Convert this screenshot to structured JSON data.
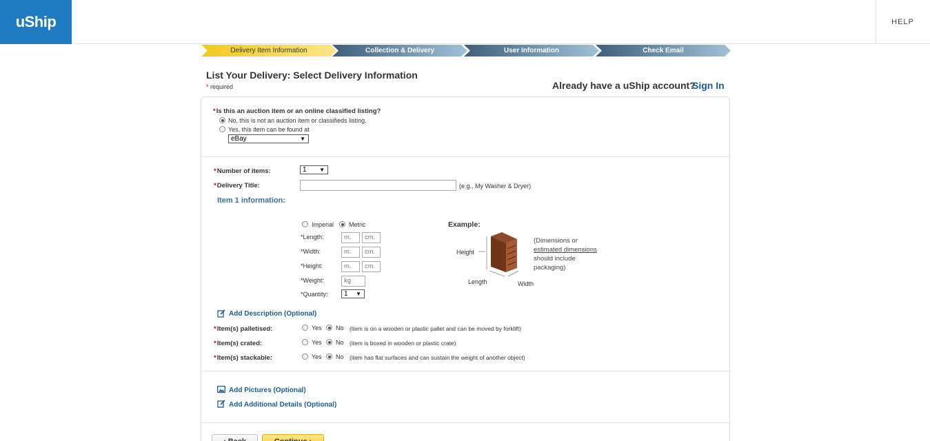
{
  "header": {
    "logo": "uShip",
    "help": "HELP",
    "brand_color": "#1f7bc1"
  },
  "steps": [
    {
      "label": "Delivery Item Information",
      "state": "active"
    },
    {
      "label": "Collection & Delivery",
      "state": "inactive"
    },
    {
      "label": "User Information",
      "state": "inactive"
    },
    {
      "label": "Check Email",
      "state": "inactive"
    }
  ],
  "page": {
    "title": "List Your Delivery:  Select Delivery Information",
    "required_star": "*",
    "required_note": "required",
    "account_question": "Already have a uShip account?",
    "sign_in": "Sign In"
  },
  "auction": {
    "question": "Is this an auction item or an online classified listing?",
    "option_no": "No, this is not an auction item or classifieds listing.",
    "option_yes": "Yes, this item can be found at",
    "selected": "no",
    "site_select": "eBay"
  },
  "items": {
    "count_label": "Number of items:",
    "count_value": "1",
    "title_label": "Delivery Title:",
    "title_value": "",
    "title_hint": "(e.g., My Washer & Dryer)",
    "item_info_heading": "Item 1 information:"
  },
  "dimensions": {
    "unit_imperial": "Imperial",
    "unit_metric": "Metric",
    "unit_selected": "metric",
    "length_label": "*Length:",
    "width_label": "*Width:",
    "height_label": "*Height:",
    "weight_label": "*Weight:",
    "quantity_label": "*Quantity:",
    "m_placeholder": "m.",
    "cm_placeholder": "cm.",
    "kg_placeholder": "kg",
    "quantity_value": "1"
  },
  "example": {
    "label": "Example:",
    "height": "Height",
    "length": "Length",
    "width": "Width",
    "note_line1": "(Dimensions or",
    "note_link": "estimated dimensions",
    "note_line3": "should include",
    "note_line4": "packaging)"
  },
  "options": {
    "add_description": "Add Description (Optional)",
    "palletised_label": "Item(s) palletised:",
    "palletised_hint": "(item is on a wooden or plastic pallet and can be moved by forklift)",
    "crated_label": "Item(s) crated:",
    "crated_hint": "(item is boxed in wooden or plastic crate)",
    "stackable_label": "Item(s) stackable:",
    "stackable_hint": "(item has flat surfaces and can sustain the weight of another object)",
    "yes": "Yes",
    "no": "No"
  },
  "extras": {
    "add_pictures": "Add Pictures (Optional)",
    "add_details": "Add Additional Details (Optional)"
  },
  "buttons": {
    "back": "‹ Back",
    "continue": "Continue ›"
  }
}
